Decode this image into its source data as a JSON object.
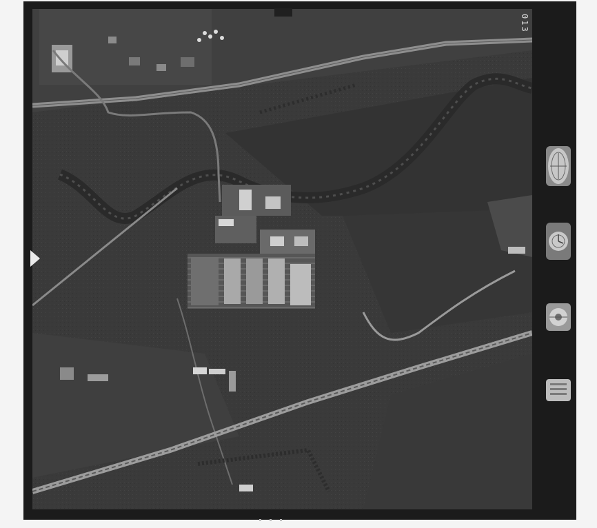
{
  "image": {
    "kind": "aerial-photograph",
    "frame_number": "013",
    "film_color": "#1b1b1b",
    "border_color": "#f4f4f4"
  },
  "instruments": [
    {
      "name": "altimeter-dial-icon"
    },
    {
      "name": "clock-dial-icon"
    },
    {
      "name": "level-bubble-icon"
    },
    {
      "name": "data-plate-icon"
    }
  ]
}
